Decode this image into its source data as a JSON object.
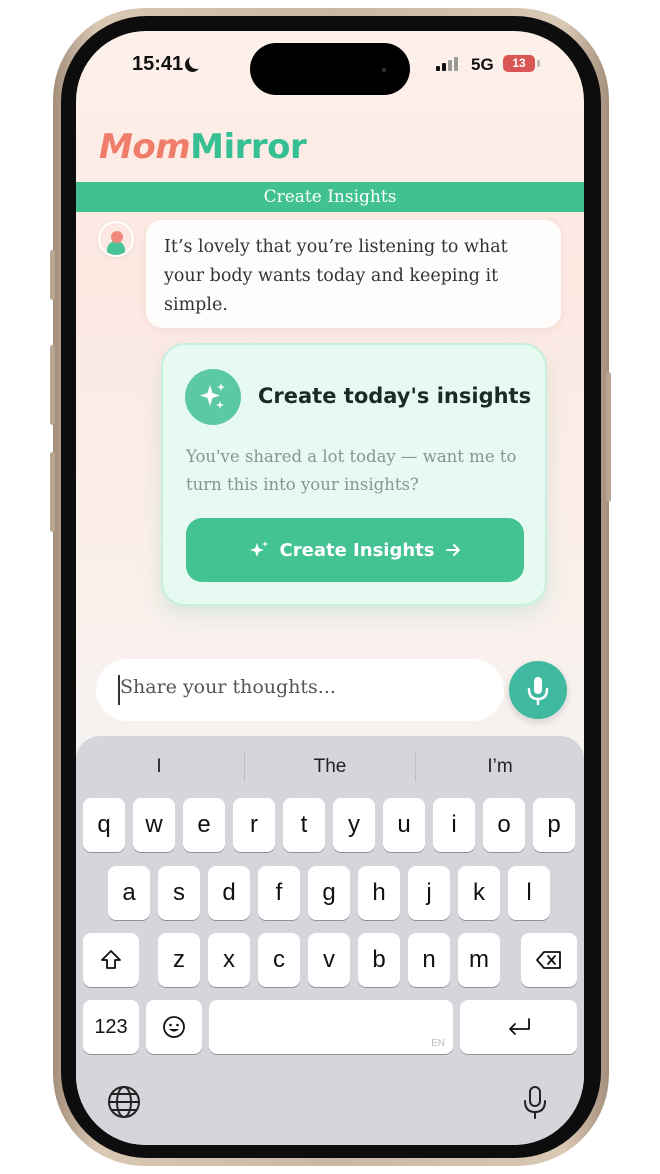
{
  "status_bar": {
    "time": "15:41",
    "network": "5G",
    "battery": "13"
  },
  "app": {
    "logo_part1": "Mom",
    "logo_part2": "Mirror",
    "banner_title": "Create Insights"
  },
  "chat": {
    "assistant_message": "It’s lovely that you’re listening to what your body wants today and keeping it simple."
  },
  "insight_card": {
    "title": "Create today's insights",
    "text": "You've shared a lot today — want me to turn this into your insights?",
    "button_label": "Create Insights"
  },
  "composer": {
    "placeholder": "Share your thoughts..."
  },
  "keyboard": {
    "suggestions": [
      "I",
      "The",
      "I’m"
    ],
    "row1": [
      "q",
      "w",
      "e",
      "r",
      "t",
      "y",
      "u",
      "i",
      "o",
      "p"
    ],
    "row2": [
      "a",
      "s",
      "d",
      "f",
      "g",
      "h",
      "j",
      "k",
      "l"
    ],
    "row3": [
      "z",
      "x",
      "c",
      "v",
      "b",
      "n",
      "m"
    ],
    "numbers_label": "123",
    "space_hint": "EN"
  },
  "colors": {
    "brand_green": "#41c191",
    "brand_coral": "#f07c6a",
    "mic_teal": "#3fb9a0"
  }
}
